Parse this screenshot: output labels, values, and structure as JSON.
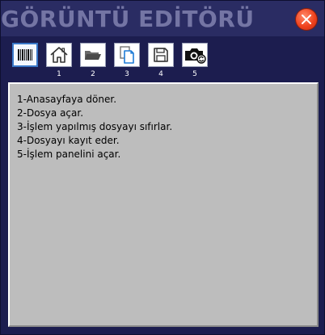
{
  "window": {
    "title": "GÖRÜNTÜ EDİTÖRÜ"
  },
  "toolbar": {
    "buttons": [
      {
        "icon": "barcode-icon",
        "number": ""
      },
      {
        "icon": "home-icon",
        "number": "1"
      },
      {
        "icon": "folder-open-icon",
        "number": "2"
      },
      {
        "icon": "copy-pages-icon",
        "number": "3"
      },
      {
        "icon": "floppy-disk-icon",
        "number": "4"
      },
      {
        "icon": "camera-icon",
        "number": "5"
      }
    ]
  },
  "help": {
    "lines": [
      "1-Anasayfaya döner.",
      "2-Dosya açar.",
      "3-İşlem yapılmış dosyayı sıfırlar.",
      "4-Dosyayı kayıt eder.",
      "5-İşlem panelini açar."
    ]
  },
  "colors": {
    "window_bg": "#1c1d4f",
    "titlebar_bg": "#2a2c63",
    "title_text": "#7475a4",
    "close_red": "#f0431e",
    "panel_bg": "#bdbdbd",
    "active_border": "#3a78c8"
  }
}
